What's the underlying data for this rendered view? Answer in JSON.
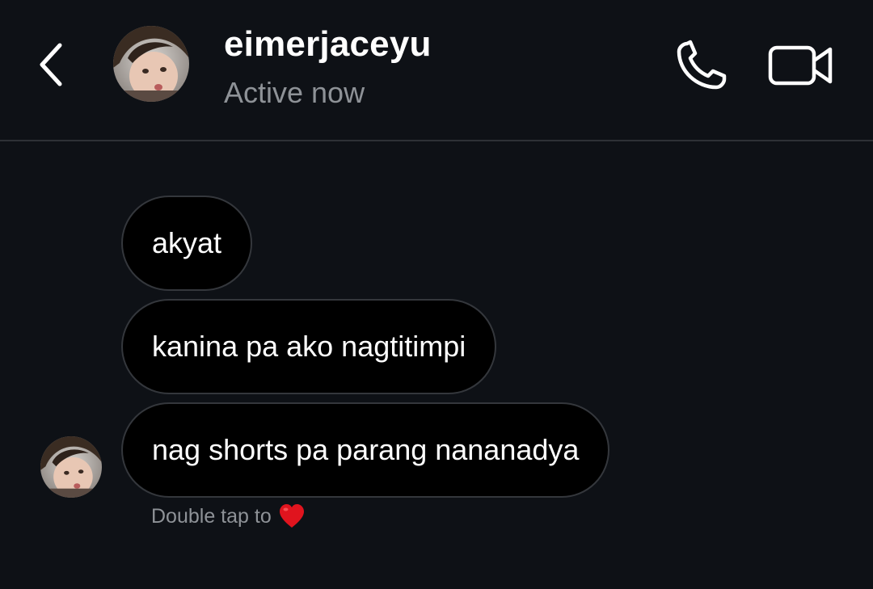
{
  "header": {
    "username": "eimerjaceyu",
    "status": "Active now"
  },
  "messages": [
    {
      "text": "akyat"
    },
    {
      "text": "kanina pa ako nagtitimpi"
    },
    {
      "text": "nag shorts pa parang nananadya"
    }
  ],
  "hint": {
    "text": "Double tap to",
    "emoji": "heart-icon"
  },
  "colors": {
    "background": "#0e1116",
    "bubble": "#000000",
    "bubble_border": "#34373c",
    "secondary_text": "#8e9297",
    "heart": "#e0141e"
  },
  "icons": [
    "chevron-left-icon",
    "phone-icon",
    "video-camera-icon",
    "heart-icon"
  ]
}
